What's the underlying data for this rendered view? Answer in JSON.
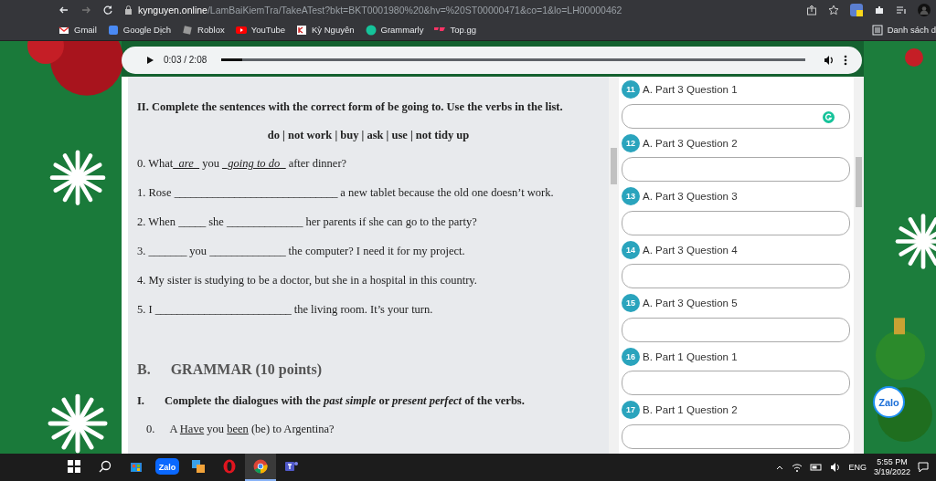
{
  "browser": {
    "url_domain": "kynguyen.online",
    "url_path": "/LamBaiKiemTra/TakeATest?bkt=BKT0001980%20&hv=%20ST00000471&co=1&lo=LH00000462",
    "bookmarks": [
      {
        "label": "Gmail",
        "kind": "gmail"
      },
      {
        "label": "Google Dịch",
        "kind": "translate"
      },
      {
        "label": "Roblox",
        "kind": "roblox"
      },
      {
        "label": "YouTube",
        "kind": "youtube"
      },
      {
        "label": "Kỳ Nguyên",
        "kind": "kn"
      },
      {
        "label": "Grammarly",
        "kind": "grammarly"
      },
      {
        "label": "Top.gg",
        "kind": "topgg"
      }
    ],
    "reading_list": "Danh sách d"
  },
  "audio": {
    "time": "0:03 / 2:08",
    "level": 0.035
  },
  "exercise": {
    "heading": "II. Complete the sentences with the correct form of be going to. Use the verbs in the list.",
    "verbs": "do | not work | buy | ask | use | not tidy up",
    "sentences": [
      [
        {
          "kind": "text",
          "text": "0. What"
        },
        {
          "kind": "answer",
          "text": "_are_"
        },
        {
          "kind": "text",
          "text": " you "
        },
        {
          "kind": "answer",
          "text": "_going to do_"
        },
        {
          "kind": "text",
          "text": " after dinner?"
        }
      ],
      [
        {
          "kind": "text",
          "text": "1. Rose "
        },
        {
          "kind": "blank",
          "text": "______________________________"
        },
        {
          "kind": "text",
          "text": " a new tablet because the old one doesn’t work."
        }
      ],
      [
        {
          "kind": "text",
          "text": "2. When "
        },
        {
          "kind": "blank",
          "text": "_____"
        },
        {
          "kind": "text",
          "text": " she "
        },
        {
          "kind": "blank",
          "text": "______________"
        },
        {
          "kind": "text",
          "text": " her parents if she can go to the party?"
        }
      ],
      [
        {
          "kind": "text",
          "text": "3. "
        },
        {
          "kind": "blank",
          "text": "_______"
        },
        {
          "kind": "text",
          "text": " you "
        },
        {
          "kind": "blank",
          "text": "______________"
        },
        {
          "kind": "text",
          "text": " the computer? I need it for my project."
        }
      ],
      [
        {
          "kind": "text",
          "text": "4. My sister is studying to be a doctor, but she in a hospital in this country."
        }
      ],
      [
        {
          "kind": "text",
          "text": "5. I "
        },
        {
          "kind": "blank",
          "text": "_________________________"
        },
        {
          "kind": "text",
          "text": " the living room. It’s your turn."
        }
      ]
    ],
    "section": {
      "letter": "B.",
      "title": "GRAMMAR (10 points)"
    },
    "instruction": {
      "number": "I.",
      "text": "Complete the dialogues with the *past simple* or *present perfect* of the verbs."
    },
    "example": {
      "number": "0.",
      "parts": [
        {
          "kind": "text",
          "text": "A "
        },
        {
          "kind": "underlined",
          "text": "Have"
        },
        {
          "kind": "text",
          "text": " you "
        },
        {
          "kind": "underlined",
          "text": "been"
        },
        {
          "kind": "text",
          "text": " (be) to Argentina?"
        }
      ]
    }
  },
  "questions": [
    {
      "number": "11",
      "label": "A. Part 3 Question 1",
      "grammarly": true
    },
    {
      "number": "12",
      "label": "A. Part 3 Question 2",
      "grammarly": false
    },
    {
      "number": "13",
      "label": "A. Part 3 Question 3",
      "grammarly": false
    },
    {
      "number": "14",
      "label": "A. Part 3 Question 4",
      "grammarly": false
    },
    {
      "number": "15",
      "label": "A. Part 3 Question 5",
      "grammarly": false
    },
    {
      "number": "16",
      "label": "B. Part 1 Question 1",
      "grammarly": false
    },
    {
      "number": "17",
      "label": "B. Part 1 Question 2",
      "grammarly": false
    }
  ],
  "zalo": "Zalo",
  "taskbar": {
    "apps": [
      {
        "kind": "store",
        "active": false
      },
      {
        "kind": "zalo",
        "label": "Zalo",
        "active": false
      },
      {
        "kind": "app",
        "active": false
      },
      {
        "kind": "opera",
        "active": false
      },
      {
        "kind": "chrome",
        "active": true
      },
      {
        "kind": "teams",
        "active": false
      }
    ],
    "language": "ENG",
    "time": "5:55 PM",
    "date": "3/19/2022"
  }
}
